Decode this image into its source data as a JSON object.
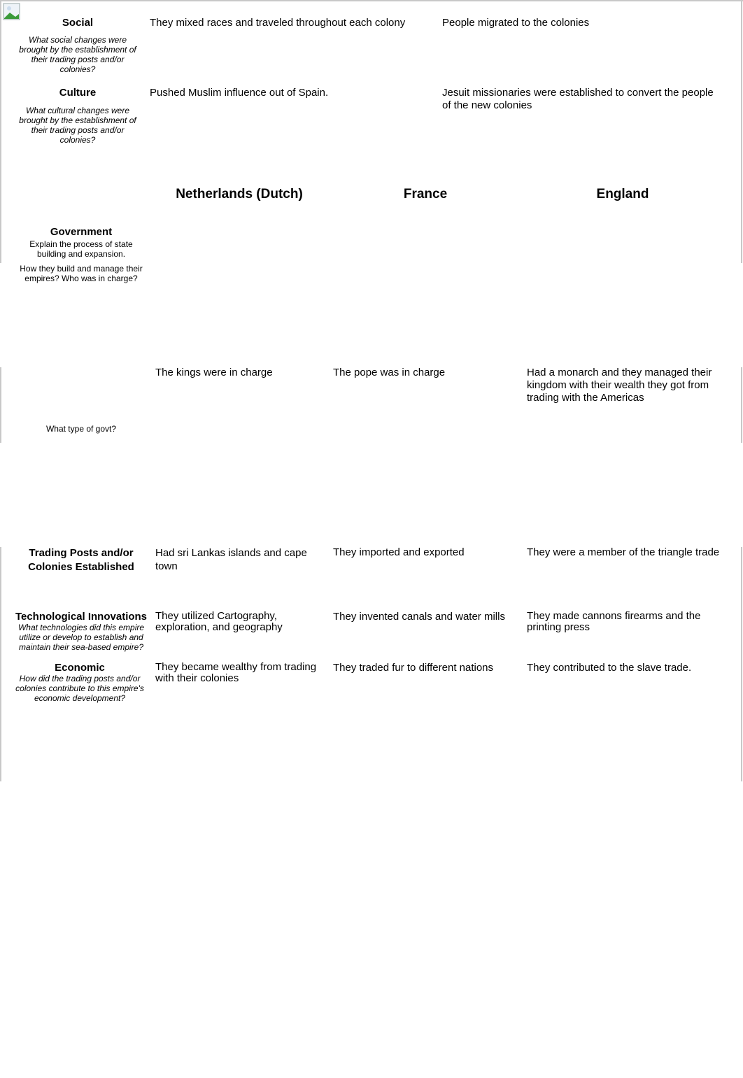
{
  "top_table": {
    "rows": [
      {
        "heading": "Social",
        "question": "What social changes were brought by the establishment of their trading posts and/or colonies?",
        "cells": [
          "They mixed races and traveled throughout each colony",
          "People migrated to the colonies"
        ]
      },
      {
        "heading": "Culture",
        "question": "What cultural changes were brought by the establishment of their trading posts and/or colonies?",
        "cells": [
          "Pushed Muslim influence out of Spain.",
          "Jesuit missionaries were established to convert the people of the new colonies"
        ]
      }
    ]
  },
  "main_table": {
    "columns": [
      "Netherlands (Dutch)",
      "France",
      "England"
    ],
    "government": {
      "heading": "Government",
      "sub1": "Explain the process of state building and expansion.",
      "sub2": "How they build and manage their empires? Who was in charge?",
      "sub3": "What type of govt?",
      "cells": [
        "The kings were in charge",
        "The pope was in charge",
        "Had a monarch and they managed their kingdom with their wealth they got from trading with the Americas"
      ]
    },
    "trading": {
      "heading": "Trading Posts and/or Colonies Established",
      "cells": [
        "Had sri Lankas islands and cape town",
        "They imported and exported",
        "They were a member of the triangle trade"
      ]
    },
    "tech": {
      "heading": "Technological Innovations",
      "question": "What technologies did this empire utilize or develop to establish and maintain their sea-based empire?",
      "cells": [
        "They utilized Cartography, exploration, and geography",
        "They invented canals and water mills",
        "They made cannons firearms and the printing press"
      ]
    },
    "economic": {
      "heading": "Economic",
      "question": "How did the trading posts and/or colonies contribute to this empire's economic development?",
      "cells": [
        "They became wealthy from trading with their colonies",
        "They traded fur to different nations",
        "They contributed to the slave trade."
      ]
    }
  },
  "icons": {
    "broken_image": "broken-image-icon"
  }
}
